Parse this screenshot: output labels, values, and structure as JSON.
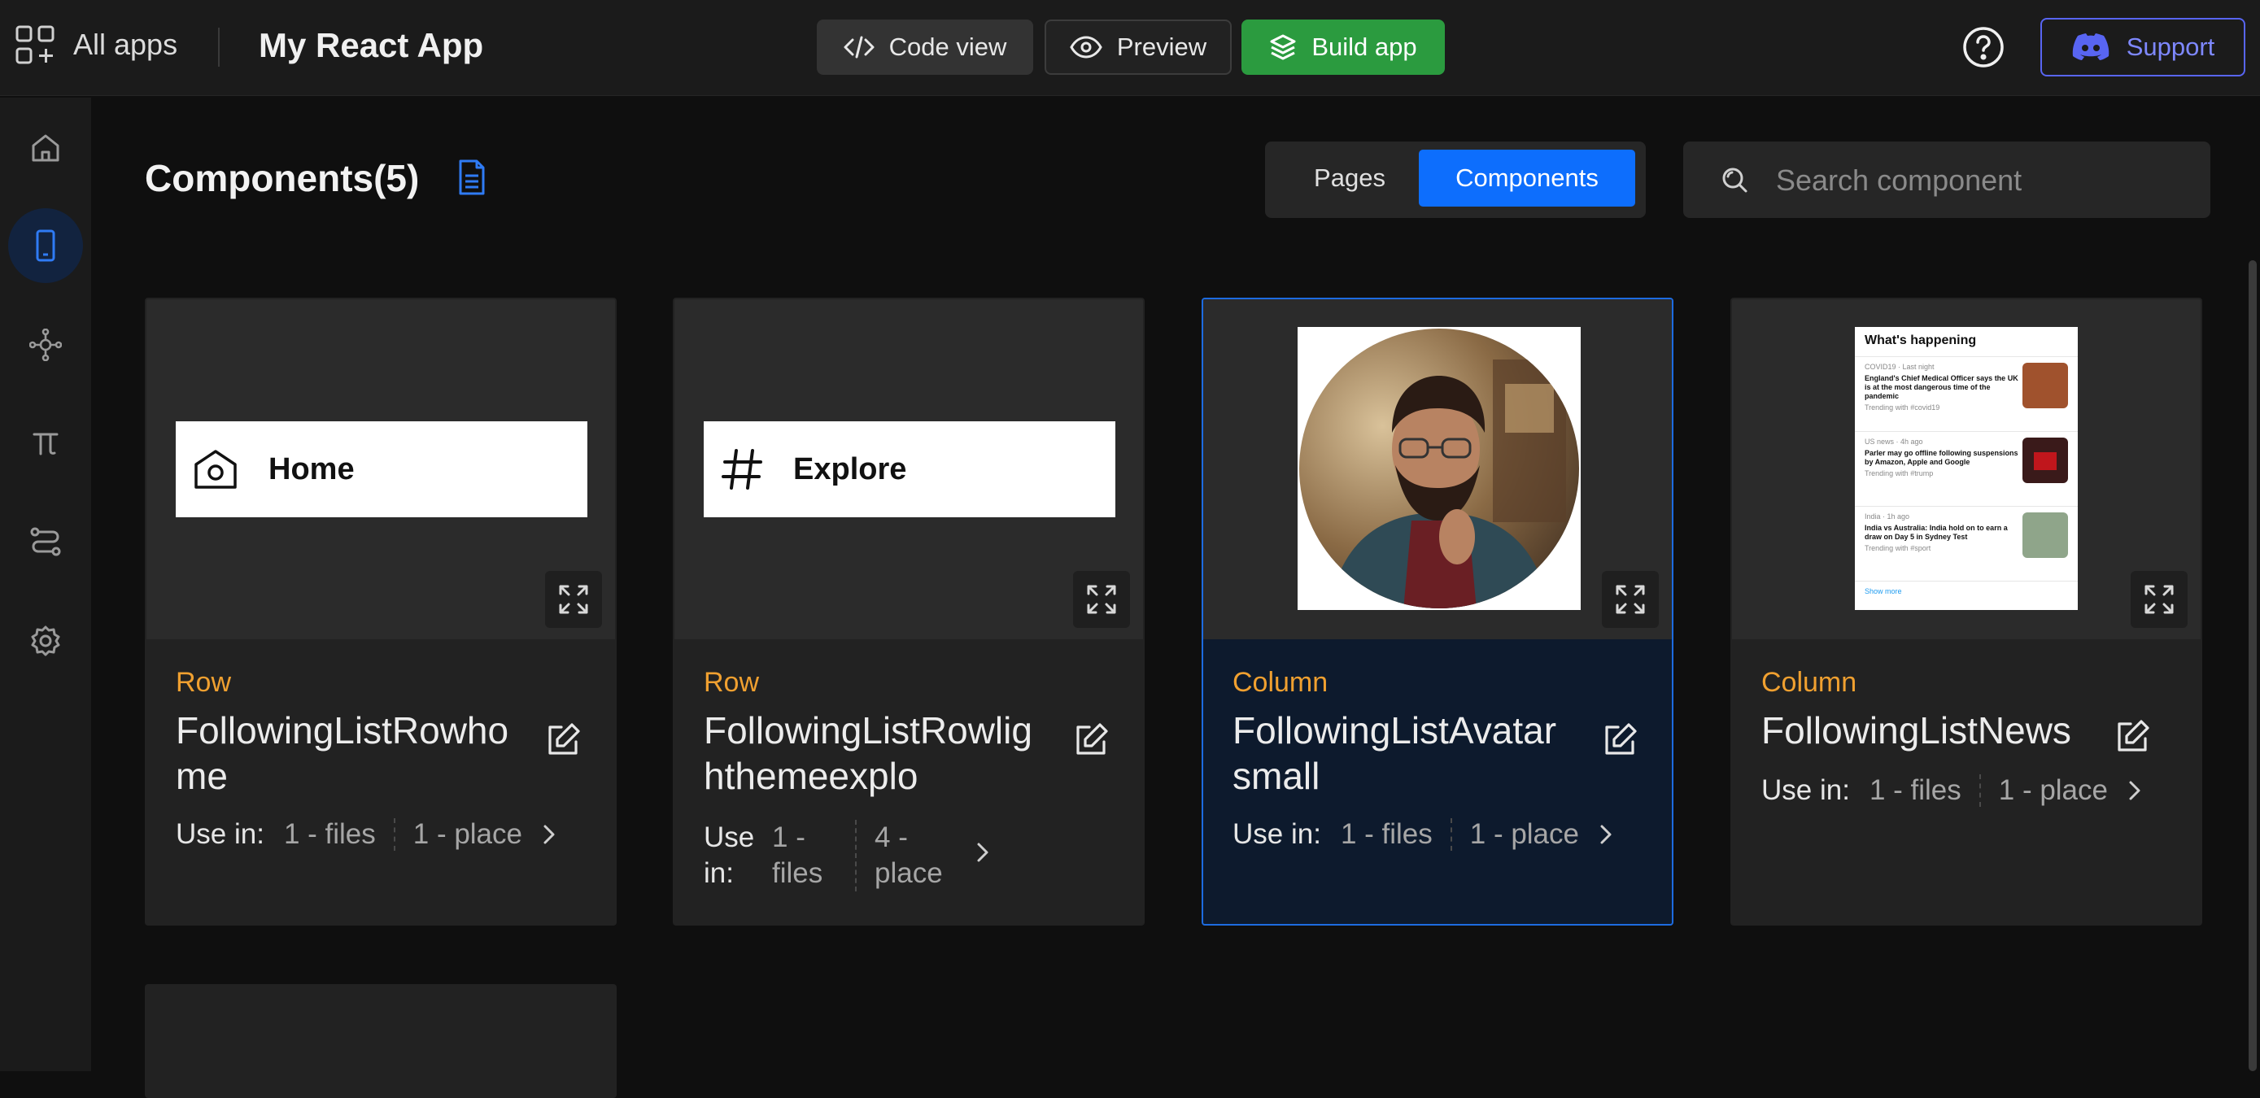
{
  "topbar": {
    "all_apps": "All apps",
    "app_title": "My React App",
    "code_view": "Code view",
    "preview": "Preview",
    "build_app": "Build app",
    "support": "Support"
  },
  "sidebar": {
    "icons": [
      "home-icon",
      "mobile-icon",
      "graph-icon",
      "pi-icon",
      "flow-icon",
      "settings-icon"
    ],
    "active": "mobile-icon"
  },
  "header": {
    "title": "Components(5)",
    "tabs": [
      "Pages",
      "Components"
    ],
    "active_tab": "Components",
    "search_placeholder": "Search component"
  },
  "cards": [
    {
      "type": "Row",
      "name": "FollowingListRowhome",
      "preview_label": "Home",
      "use_in_label": "Use in:",
      "files": "1 - files",
      "place": "1 - place"
    },
    {
      "type": "Row",
      "name": "FollowingListRowlighthemeexplo",
      "preview_label": "Explore",
      "use_in_label": "Use in:",
      "files": "1 - files",
      "place": "4 - place"
    },
    {
      "type": "Column",
      "name": "FollowingListAvatarsmall",
      "use_in_label": "Use in:",
      "files": "1 - files",
      "place": "1 - place"
    },
    {
      "type": "Column",
      "name": "FollowingListNews",
      "use_in_label": "Use in:",
      "files": "1 - files",
      "place": "1 - place"
    }
  ],
  "news_preview": {
    "title": "What's happening",
    "items": [
      {
        "meta": "COVID19 · Last night",
        "headline": "England's Chief Medical Officer says the UK is at the most dangerous time of the pandemic",
        "trend": "Trending with #covid19"
      },
      {
        "meta": "US news · 4h ago",
        "headline": "Parler may go offline following suspensions by Amazon, Apple and Google",
        "trend": "Trending with #trump"
      },
      {
        "meta": "India · 1h ago",
        "headline": "India vs Australia: India hold on to earn a draw on Day 5 in Sydney Test",
        "trend": "Trending with #sport"
      }
    ],
    "show_more": "Show more"
  },
  "colors": {
    "accent": "#0d6efd",
    "build": "#2b9b3f",
    "support": "#5865f2",
    "type_label": "#f0a030"
  }
}
